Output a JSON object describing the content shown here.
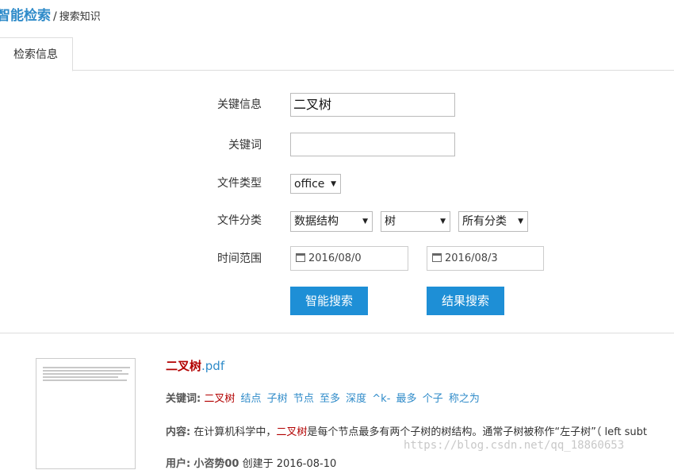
{
  "breadcrumb": {
    "app": "智能检索",
    "sep": "/",
    "page": "搜索知识"
  },
  "tab": {
    "label": "检索信息"
  },
  "form": {
    "keyinfo_label": "关键信息",
    "keyinfo_value": "二叉树",
    "keyword_label": "关键词",
    "keyword_value": "",
    "filetype_label": "文件类型",
    "filetype_value": "office",
    "category_label": "文件分类",
    "category1": "数据结构",
    "category2": "树",
    "category3": "所有分类",
    "timerange_label": "时间范围",
    "date_from": "2016/08/0",
    "date_to": "2016/08/3",
    "smart_search_button": "智能搜索",
    "result_search_button": "结果搜索"
  },
  "result": {
    "title_highlight": "二叉树",
    "title_ext": ".pdf",
    "keywords_label": "关键词:",
    "keywords": [
      "二叉树",
      "结点",
      "子树",
      "节点",
      "至多",
      "深度",
      "^k-",
      "最多",
      "个子",
      "称之为"
    ],
    "content_label": "内容:",
    "content_pre": " 在计算机科学中，",
    "content_highlight": "二叉树",
    "content_post": "是每个节点最多有两个子树的树结构。通常子树被称作“左子树”（ left subt",
    "user_label": "用户:",
    "user_name": "小咨势00",
    "created_text": " 创建于 2016-08-10"
  },
  "watermark": "https://blog.csdn.net/qq_18860653"
}
